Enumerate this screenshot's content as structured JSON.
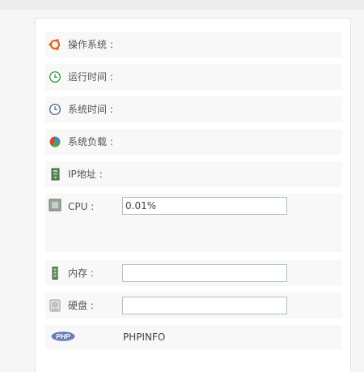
{
  "rows": [
    {
      "label": "操作系统 :",
      "icon": "ubuntu-icon"
    },
    {
      "label": "运行时间 :",
      "icon": "clock-green-icon"
    },
    {
      "label": "系统时间 :",
      "icon": "clock-icon"
    },
    {
      "label": "系统负载 :",
      "icon": "pie-chart-icon"
    },
    {
      "label": "IP地址 :",
      "icon": "server-icon"
    },
    {
      "label": "CPU :",
      "icon": "cpu-icon",
      "value": "0.01%"
    },
    {
      "label": "内存 :",
      "icon": "memory-icon",
      "value": ""
    },
    {
      "label": "硬盘 :",
      "icon": "disk-icon",
      "value": ""
    },
    {
      "badge": "PHP",
      "link": "PHPINFO",
      "icon": "php-icon"
    }
  ]
}
